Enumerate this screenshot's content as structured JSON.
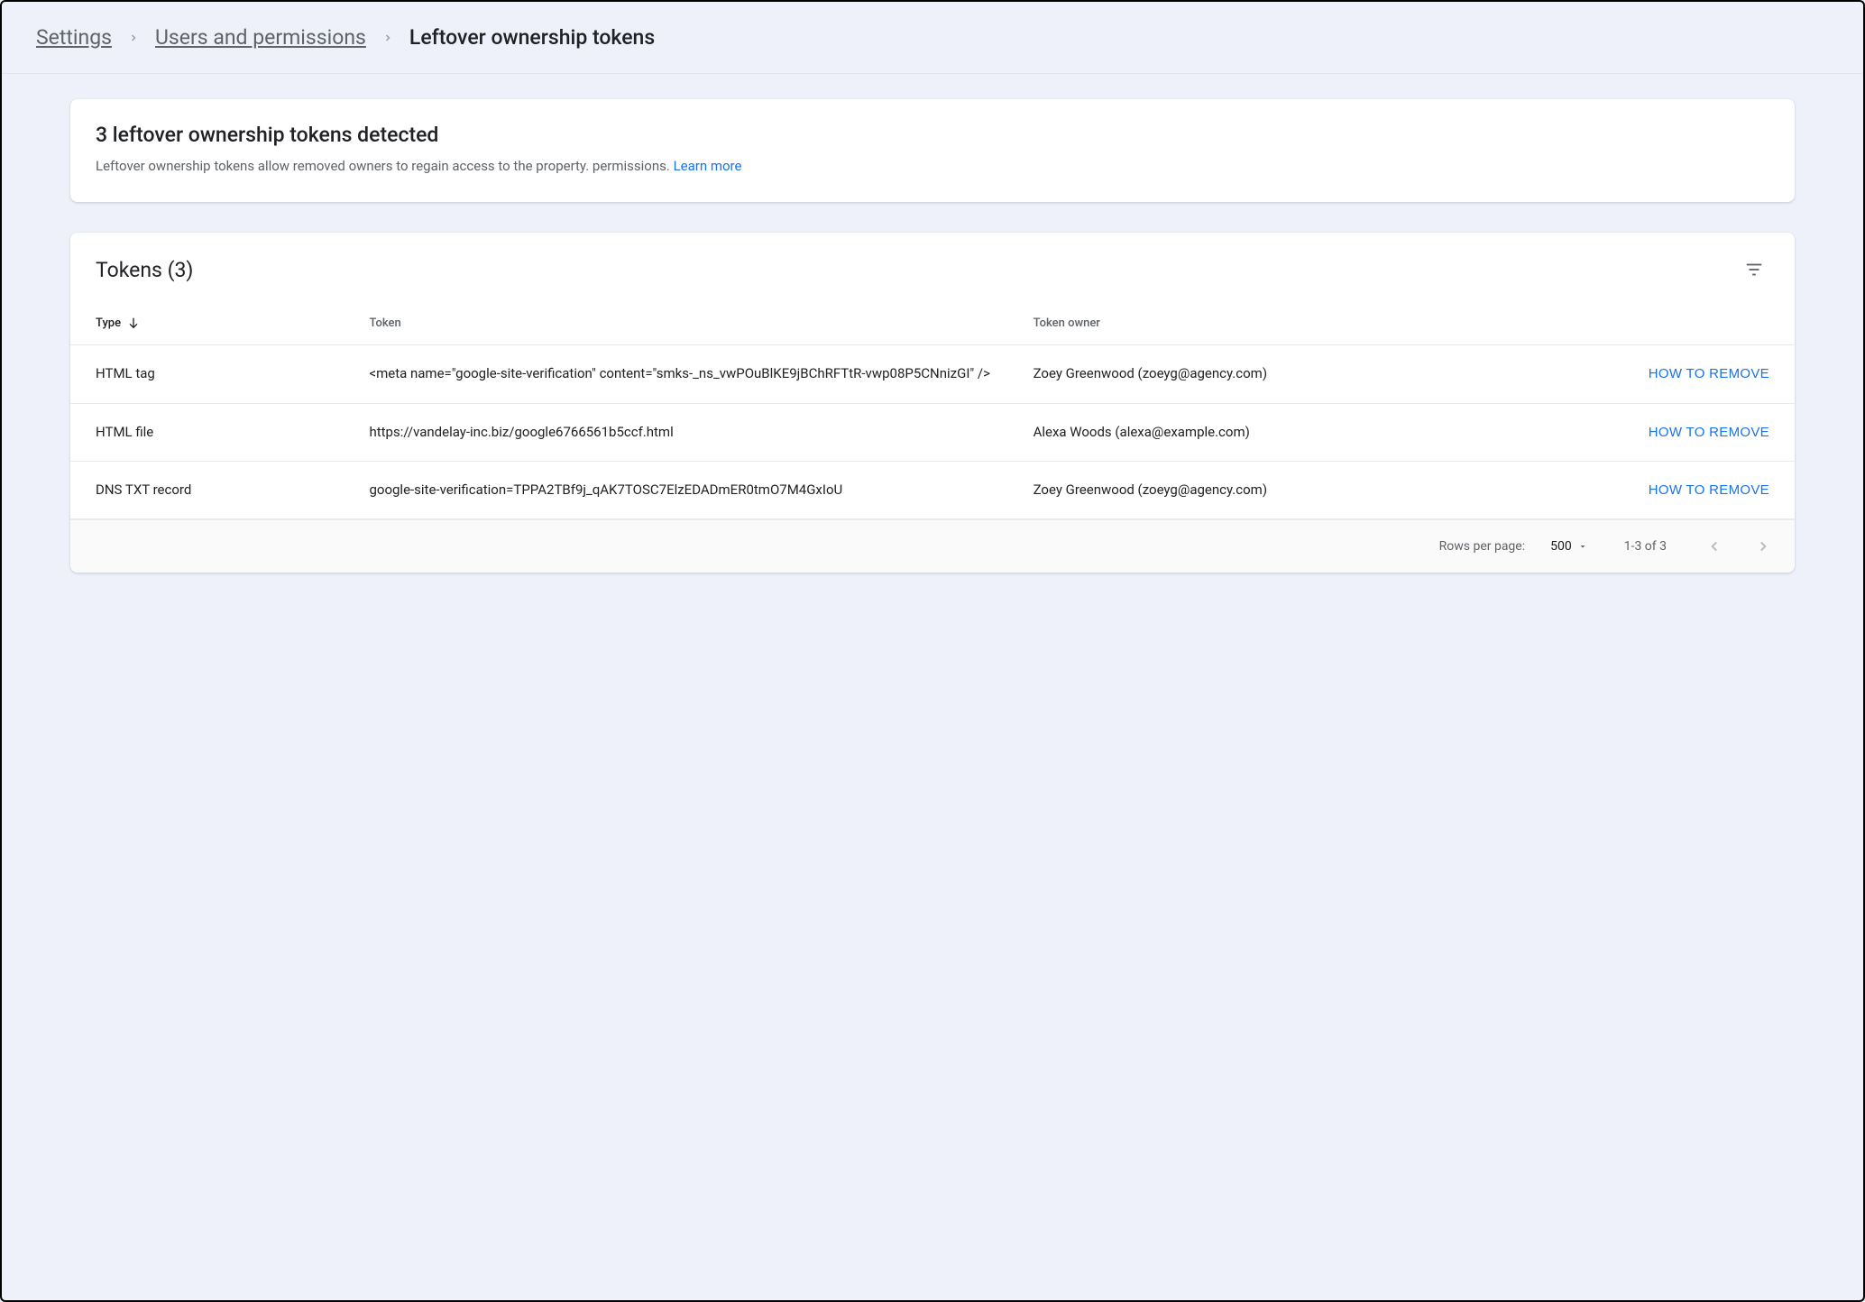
{
  "breadcrumbs": {
    "items": [
      "Settings",
      "Users and permissions",
      "Leftover ownership tokens"
    ]
  },
  "info": {
    "title": "3 leftover ownership tokens detected",
    "body": "Leftover ownership tokens allow removed owners to regain access to the property. permissions. ",
    "learn_more": "Learn more"
  },
  "table": {
    "title": "Tokens (3)",
    "columns": {
      "type": "Type",
      "token": "Token",
      "owner": "Token owner"
    },
    "action_label": "HOW TO REMOVE",
    "rows": [
      {
        "type": "HTML tag",
        "token": "<meta name=\"google-site-verification\" content=\"smks-_ns_vwPOuBlKE9jBChRFTtR-vwp08P5CNnizGI\" />",
        "owner": "Zoey Greenwood (zoeyg@agency.com)"
      },
      {
        "type": "HTML file",
        "token": "https://vandelay-inc.biz/google6766561b5ccf.html",
        "owner": "Alexa Woods (alexa@example.com)"
      },
      {
        "type": "DNS TXT record",
        "token": "google-site-verification=TPPA2TBf9j_qAK7TOSC7ElzEDADmER0tmO7M4GxIoU",
        "owner": "Zoey Greenwood (zoeyg@agency.com)"
      }
    ]
  },
  "pagination": {
    "rows_label": "Rows per page:",
    "rows_value": "500",
    "range": "1-3 of 3"
  }
}
